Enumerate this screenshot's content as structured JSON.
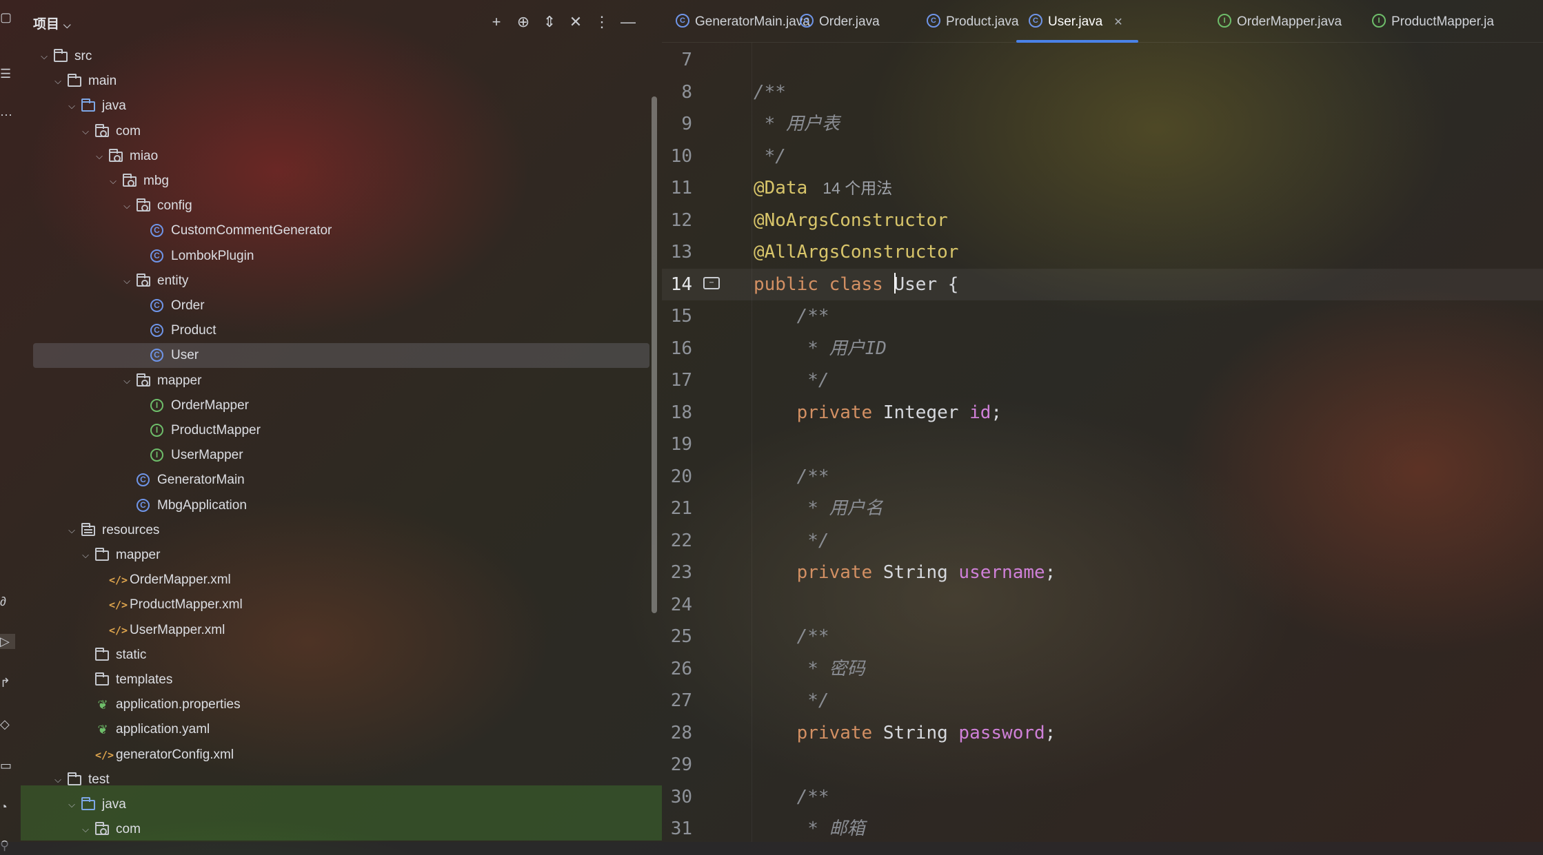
{
  "project_panel": {
    "title": "项目",
    "toolbar": [
      "add-icon",
      "locate-icon",
      "expand-all-icon",
      "collapse-all-icon",
      "more-options-icon",
      "hide-icon"
    ]
  },
  "tree": [
    {
      "label": "src",
      "depth": 0,
      "icon": "folder",
      "expanded": true
    },
    {
      "label": "main",
      "depth": 1,
      "icon": "folder",
      "expanded": true
    },
    {
      "label": "java",
      "depth": 2,
      "icon": "source-folder",
      "expanded": true
    },
    {
      "label": "com",
      "depth": 3,
      "icon": "package",
      "expanded": true
    },
    {
      "label": "miao",
      "depth": 4,
      "icon": "package",
      "expanded": true
    },
    {
      "label": "mbg",
      "depth": 5,
      "icon": "package",
      "expanded": true
    },
    {
      "label": "config",
      "depth": 6,
      "icon": "package",
      "expanded": true
    },
    {
      "label": "CustomCommentGenerator",
      "depth": 7,
      "icon": "class"
    },
    {
      "label": "LombokPlugin",
      "depth": 7,
      "icon": "class"
    },
    {
      "label": "entity",
      "depth": 6,
      "icon": "package",
      "expanded": true
    },
    {
      "label": "Order",
      "depth": 7,
      "icon": "class"
    },
    {
      "label": "Product",
      "depth": 7,
      "icon": "class"
    },
    {
      "label": "User",
      "depth": 7,
      "icon": "class",
      "selected": true
    },
    {
      "label": "mapper",
      "depth": 6,
      "icon": "package",
      "expanded": true
    },
    {
      "label": "OrderMapper",
      "depth": 7,
      "icon": "interface"
    },
    {
      "label": "ProductMapper",
      "depth": 7,
      "icon": "interface"
    },
    {
      "label": "UserMapper",
      "depth": 7,
      "icon": "interface"
    },
    {
      "label": "GeneratorMain",
      "depth": 6,
      "icon": "class"
    },
    {
      "label": "MbgApplication",
      "depth": 6,
      "icon": "class"
    },
    {
      "label": "resources",
      "depth": 2,
      "icon": "resources-folder",
      "expanded": true
    },
    {
      "label": "mapper",
      "depth": 3,
      "icon": "folder",
      "expanded": true
    },
    {
      "label": "OrderMapper.xml",
      "depth": 4,
      "icon": "xml"
    },
    {
      "label": "ProductMapper.xml",
      "depth": 4,
      "icon": "xml"
    },
    {
      "label": "UserMapper.xml",
      "depth": 4,
      "icon": "xml"
    },
    {
      "label": "static",
      "depth": 3,
      "icon": "folder"
    },
    {
      "label": "templates",
      "depth": 3,
      "icon": "folder"
    },
    {
      "label": "application.properties",
      "depth": 3,
      "icon": "properties"
    },
    {
      "label": "application.yaml",
      "depth": 3,
      "icon": "properties"
    },
    {
      "label": "generatorConfig.xml",
      "depth": 3,
      "icon": "xml"
    },
    {
      "label": "test",
      "depth": 1,
      "icon": "folder",
      "expanded": true
    },
    {
      "label": "java",
      "depth": 2,
      "icon": "source-folder",
      "expanded": true
    },
    {
      "label": "com",
      "depth": 3,
      "icon": "package",
      "expanded": true
    }
  ],
  "tabs": [
    {
      "label": "GeneratorMain.java",
      "icon": "class"
    },
    {
      "label": "Order.java",
      "icon": "class"
    },
    {
      "label": "Product.java",
      "icon": "class"
    },
    {
      "label": "User.java",
      "icon": "class",
      "active": true
    },
    {
      "label": "OrderMapper.java",
      "icon": "interface"
    },
    {
      "label": "ProductMapper.ja",
      "icon": "interface"
    }
  ],
  "editor": {
    "current_line": 14,
    "lines": [
      {
        "n": "7",
        "tokens": []
      },
      {
        "n": "8",
        "tokens": [
          {
            "t": "/**",
            "c": "cmt"
          }
        ]
      },
      {
        "n": "9",
        "tokens": [
          {
            "t": " * 用户表",
            "c": "cmt"
          }
        ]
      },
      {
        "n": "10",
        "tokens": [
          {
            "t": " */",
            "c": "cmt"
          }
        ]
      },
      {
        "n": "11",
        "tokens": [
          {
            "t": "@Data",
            "c": "ann"
          },
          {
            "t": "14 个用法",
            "c": "hint"
          }
        ]
      },
      {
        "n": "12",
        "tokens": [
          {
            "t": "@NoArgsConstructor",
            "c": "ann"
          }
        ]
      },
      {
        "n": "13",
        "tokens": [
          {
            "t": "@AllArgsConstructor",
            "c": "ann"
          }
        ]
      },
      {
        "n": "14",
        "tokens": [
          {
            "t": "public class ",
            "c": "kw"
          },
          {
            "t": "",
            "c": "caret"
          },
          {
            "t": "User {",
            "c": "plain"
          }
        ]
      },
      {
        "n": "15",
        "tokens": [
          {
            "t": "    /**",
            "c": "cmt"
          }
        ]
      },
      {
        "n": "16",
        "tokens": [
          {
            "t": "     * 用户ID",
            "c": "cmt"
          }
        ]
      },
      {
        "n": "17",
        "tokens": [
          {
            "t": "     */",
            "c": "cmt"
          }
        ]
      },
      {
        "n": "18",
        "tokens": [
          {
            "t": "    private ",
            "c": "kw"
          },
          {
            "t": "Integer ",
            "c": "plain"
          },
          {
            "t": "id",
            "c": "fld"
          },
          {
            "t": ";",
            "c": "plain"
          }
        ]
      },
      {
        "n": "19",
        "tokens": []
      },
      {
        "n": "20",
        "tokens": [
          {
            "t": "    /**",
            "c": "cmt"
          }
        ]
      },
      {
        "n": "21",
        "tokens": [
          {
            "t": "     * 用户名",
            "c": "cmt"
          }
        ]
      },
      {
        "n": "22",
        "tokens": [
          {
            "t": "     */",
            "c": "cmt"
          }
        ]
      },
      {
        "n": "23",
        "tokens": [
          {
            "t": "    private ",
            "c": "kw"
          },
          {
            "t": "String ",
            "c": "plain"
          },
          {
            "t": "username",
            "c": "fld"
          },
          {
            "t": ";",
            "c": "plain"
          }
        ]
      },
      {
        "n": "24",
        "tokens": []
      },
      {
        "n": "25",
        "tokens": [
          {
            "t": "    /**",
            "c": "cmt"
          }
        ]
      },
      {
        "n": "26",
        "tokens": [
          {
            "t": "     * 密码",
            "c": "cmt"
          }
        ]
      },
      {
        "n": "27",
        "tokens": [
          {
            "t": "     */",
            "c": "cmt"
          }
        ]
      },
      {
        "n": "28",
        "tokens": [
          {
            "t": "    private ",
            "c": "kw"
          },
          {
            "t": "String ",
            "c": "plain"
          },
          {
            "t": "password",
            "c": "fld"
          },
          {
            "t": ";",
            "c": "plain"
          }
        ]
      },
      {
        "n": "29",
        "tokens": []
      },
      {
        "n": "30",
        "tokens": [
          {
            "t": "    /**",
            "c": "cmt"
          }
        ]
      },
      {
        "n": "31",
        "tokens": [
          {
            "t": "     * 邮箱",
            "c": "cmt"
          }
        ]
      }
    ]
  },
  "colors": {
    "accent": "#4a82e8",
    "class_icon": "#6f95e8",
    "interface_icon": "#6ebd6a",
    "keyword": "#d39063",
    "annotation": "#d8c56a",
    "field": "#cf80d8",
    "comment": "#8a8d93"
  }
}
